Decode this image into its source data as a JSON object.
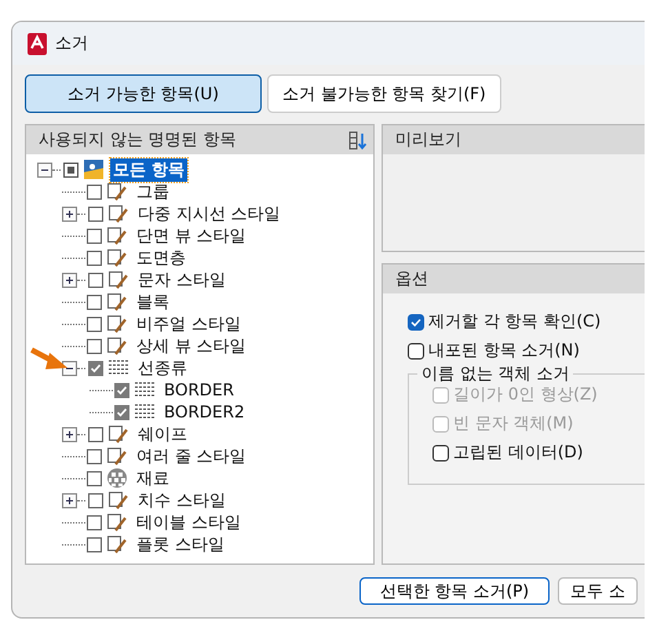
{
  "window": {
    "title": "소거"
  },
  "tabs": [
    {
      "label": "소거 가능한 항목(U)",
      "selected": true
    },
    {
      "label": "소거 불가능한 항목 찾기(F)",
      "selected": false
    }
  ],
  "tree_panel": {
    "title": "사용되지 않는 명명된 항목"
  },
  "tree": [
    {
      "label": "모든 항목",
      "selected": true,
      "indeterminate": true,
      "expanded": true,
      "children": [
        {
          "label": "그룹",
          "selected": false,
          "checked": false
        },
        {
          "label": "다중 지시선 스타일",
          "selected": false,
          "checked": false,
          "expanded": false
        },
        {
          "label": "단면 뷰 스타일",
          "selected": false,
          "checked": false
        },
        {
          "label": "도면층",
          "selected": false,
          "checked": false
        },
        {
          "label": "문자 스타일",
          "selected": false,
          "checked": false,
          "expanded": false
        },
        {
          "label": "블록",
          "selected": false,
          "checked": false
        },
        {
          "label": "비주얼 스타일",
          "selected": false,
          "checked": false
        },
        {
          "label": "상세 뷰 스타일",
          "selected": false,
          "checked": false
        },
        {
          "label": "선종류",
          "selected": false,
          "checked": true,
          "expanded": true,
          "children": [
            {
              "label": "BORDER",
              "selected": false,
              "checked": true
            },
            {
              "label": "BORDER2",
              "selected": false,
              "checked": true
            }
          ]
        },
        {
          "label": "쉐이프",
          "selected": false,
          "checked": false,
          "expanded": false
        },
        {
          "label": "여러 줄 스타일",
          "selected": false,
          "checked": false
        },
        {
          "label": "재료",
          "selected": false,
          "checked": false
        },
        {
          "label": "치수 스타일",
          "selected": false,
          "checked": false,
          "expanded": false
        },
        {
          "label": "테이블 스타일",
          "selected": false,
          "checked": false
        },
        {
          "label": "플롯 스타일",
          "selected": false,
          "checked": false
        }
      ]
    }
  ],
  "preview": {
    "title": "미리보기"
  },
  "options": {
    "title": "옵션",
    "items": [
      {
        "label": "제거할 각 항목 확인(C)",
        "checked": true,
        "disabled": false
      },
      {
        "label": "내포된 항목 소거(N)",
        "checked": false,
        "disabled": false
      }
    ],
    "group": {
      "title": "이름 없는 객체 소거",
      "items": [
        {
          "label": "길이가 0인 형상(Z)",
          "checked": false,
          "disabled": true
        },
        {
          "label": "빈 문자 객체(M)",
          "checked": false,
          "disabled": true
        },
        {
          "label": "고립된 데이터(D)",
          "checked": false,
          "disabled": false
        }
      ]
    }
  },
  "buttons": [
    {
      "label": "선택한 항목 소거(P)",
      "focused": true
    },
    {
      "label": "모두 소",
      "focused": false
    }
  ]
}
